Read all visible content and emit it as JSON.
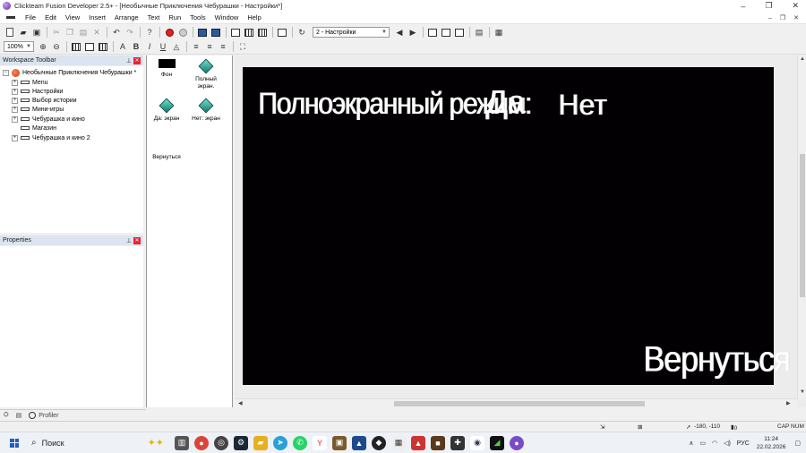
{
  "window": {
    "title": "Clickteam Fusion Developer 2.5+ - [Необычные Приключения Чебурашки - Настройки*]"
  },
  "menu": [
    "File",
    "Edit",
    "View",
    "Insert",
    "Arrange",
    "Text",
    "Run",
    "Tools",
    "Window",
    "Help"
  ],
  "toolbar": {
    "frame_select": "2 - Настройки",
    "zoom": "100%"
  },
  "workspace": {
    "header": "Workspace Toolbar",
    "root": "Необычные Приключения Чебурашки *",
    "frames": [
      "Menu",
      "Настройки",
      "Выбор истории",
      "Мини-игры",
      "Чебурашка и кино",
      "Магазин",
      "Чебурашка и кино 2"
    ]
  },
  "properties": {
    "header": "Properties"
  },
  "objects": [
    {
      "name": "Фон",
      "icon": "black-rect-icon"
    },
    {
      "name": "Полный экран.",
      "icon": "active-object-icon"
    },
    {
      "name": "Да: экран",
      "icon": "active-object-icon"
    },
    {
      "name": "Нет: экран",
      "icon": "active-object-icon"
    },
    {
      "name": "Вернуться",
      "icon": "text-object-icon"
    }
  ],
  "frame_content": {
    "fullscreen_label": "Полноэкранный режим:",
    "yes": "Да",
    "no": "Нет",
    "back": "Вернуться",
    "background": "#030004"
  },
  "bottom_tabs": {
    "profiler": "Profiler"
  },
  "status": {
    "caps": "CAP NUM",
    "coords": "-180, -110",
    "count": "0"
  },
  "taskbar": {
    "search": "Поиск",
    "lang": "РУС",
    "time": "11:24",
    "date": "22.02.2026"
  }
}
